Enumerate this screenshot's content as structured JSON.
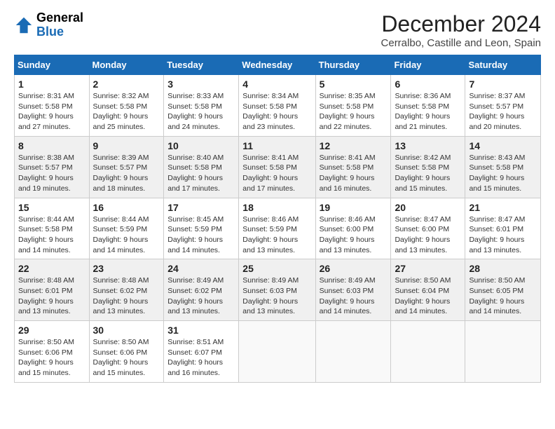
{
  "header": {
    "logo_text_general": "General",
    "logo_text_blue": "Blue",
    "main_title": "December 2024",
    "subtitle": "Cerralbo, Castille and Leon, Spain"
  },
  "calendar": {
    "days_of_week": [
      "Sunday",
      "Monday",
      "Tuesday",
      "Wednesday",
      "Thursday",
      "Friday",
      "Saturday"
    ],
    "weeks": [
      [
        null,
        {
          "day": "1",
          "sunrise": "8:31 AM",
          "sunset": "5:58 PM",
          "daylight": "9 hours and 27 minutes."
        },
        {
          "day": "2",
          "sunrise": "8:32 AM",
          "sunset": "5:58 PM",
          "daylight": "9 hours and 25 minutes."
        },
        {
          "day": "3",
          "sunrise": "8:33 AM",
          "sunset": "5:58 PM",
          "daylight": "9 hours and 24 minutes."
        },
        {
          "day": "4",
          "sunrise": "8:34 AM",
          "sunset": "5:58 PM",
          "daylight": "9 hours and 23 minutes."
        },
        {
          "day": "5",
          "sunrise": "8:35 AM",
          "sunset": "5:58 PM",
          "daylight": "9 hours and 22 minutes."
        },
        {
          "day": "6",
          "sunrise": "8:36 AM",
          "sunset": "5:58 PM",
          "daylight": "9 hours and 21 minutes."
        },
        {
          "day": "7",
          "sunrise": "8:37 AM",
          "sunset": "5:57 PM",
          "daylight": "9 hours and 20 minutes."
        }
      ],
      [
        {
          "day": "8",
          "sunrise": "8:38 AM",
          "sunset": "5:57 PM",
          "daylight": "9 hours and 19 minutes."
        },
        {
          "day": "9",
          "sunrise": "8:39 AM",
          "sunset": "5:57 PM",
          "daylight": "9 hours and 18 minutes."
        },
        {
          "day": "10",
          "sunrise": "8:40 AM",
          "sunset": "5:58 PM",
          "daylight": "9 hours and 17 minutes."
        },
        {
          "day": "11",
          "sunrise": "8:41 AM",
          "sunset": "5:58 PM",
          "daylight": "9 hours and 17 minutes."
        },
        {
          "day": "12",
          "sunrise": "8:41 AM",
          "sunset": "5:58 PM",
          "daylight": "9 hours and 16 minutes."
        },
        {
          "day": "13",
          "sunrise": "8:42 AM",
          "sunset": "5:58 PM",
          "daylight": "9 hours and 15 minutes."
        },
        {
          "day": "14",
          "sunrise": "8:43 AM",
          "sunset": "5:58 PM",
          "daylight": "9 hours and 15 minutes."
        }
      ],
      [
        {
          "day": "15",
          "sunrise": "8:44 AM",
          "sunset": "5:58 PM",
          "daylight": "9 hours and 14 minutes."
        },
        {
          "day": "16",
          "sunrise": "8:44 AM",
          "sunset": "5:59 PM",
          "daylight": "9 hours and 14 minutes."
        },
        {
          "day": "17",
          "sunrise": "8:45 AM",
          "sunset": "5:59 PM",
          "daylight": "9 hours and 14 minutes."
        },
        {
          "day": "18",
          "sunrise": "8:46 AM",
          "sunset": "5:59 PM",
          "daylight": "9 hours and 13 minutes."
        },
        {
          "day": "19",
          "sunrise": "8:46 AM",
          "sunset": "6:00 PM",
          "daylight": "9 hours and 13 minutes."
        },
        {
          "day": "20",
          "sunrise": "8:47 AM",
          "sunset": "6:00 PM",
          "daylight": "9 hours and 13 minutes."
        },
        {
          "day": "21",
          "sunrise": "8:47 AM",
          "sunset": "6:01 PM",
          "daylight": "9 hours and 13 minutes."
        }
      ],
      [
        {
          "day": "22",
          "sunrise": "8:48 AM",
          "sunset": "6:01 PM",
          "daylight": "9 hours and 13 minutes."
        },
        {
          "day": "23",
          "sunrise": "8:48 AM",
          "sunset": "6:02 PM",
          "daylight": "9 hours and 13 minutes."
        },
        {
          "day": "24",
          "sunrise": "8:49 AM",
          "sunset": "6:02 PM",
          "daylight": "9 hours and 13 minutes."
        },
        {
          "day": "25",
          "sunrise": "8:49 AM",
          "sunset": "6:03 PM",
          "daylight": "9 hours and 13 minutes."
        },
        {
          "day": "26",
          "sunrise": "8:49 AM",
          "sunset": "6:03 PM",
          "daylight": "9 hours and 14 minutes."
        },
        {
          "day": "27",
          "sunrise": "8:50 AM",
          "sunset": "6:04 PM",
          "daylight": "9 hours and 14 minutes."
        },
        {
          "day": "28",
          "sunrise": "8:50 AM",
          "sunset": "6:05 PM",
          "daylight": "9 hours and 14 minutes."
        }
      ],
      [
        {
          "day": "29",
          "sunrise": "8:50 AM",
          "sunset": "6:06 PM",
          "daylight": "9 hours and 15 minutes."
        },
        {
          "day": "30",
          "sunrise": "8:50 AM",
          "sunset": "6:06 PM",
          "daylight": "9 hours and 15 minutes."
        },
        {
          "day": "31",
          "sunrise": "8:51 AM",
          "sunset": "6:07 PM",
          "daylight": "9 hours and 16 minutes."
        },
        null,
        null,
        null,
        null
      ]
    ]
  }
}
